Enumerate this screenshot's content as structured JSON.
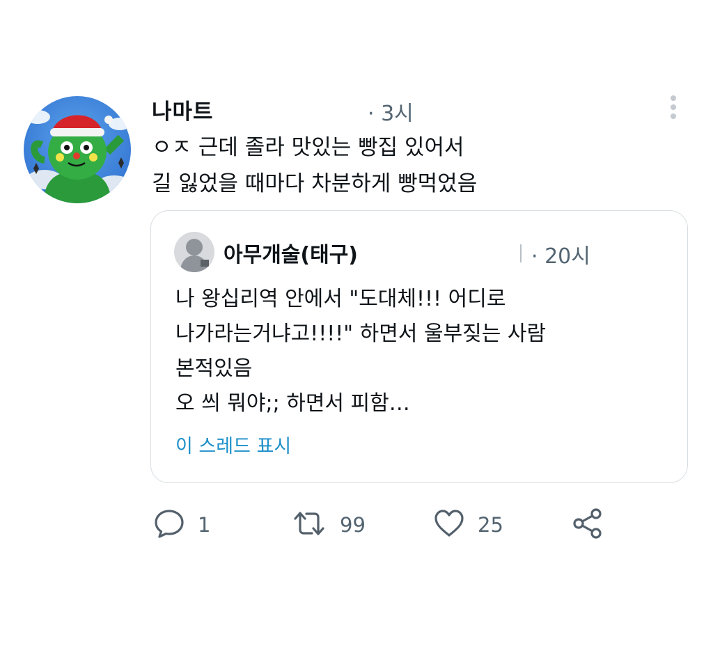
{
  "tweet": {
    "author_name": "나마트",
    "timestamp": "· 3시",
    "text_lines": [
      "ㅇㅈ 근데 졸라 맛있는 빵집 있어서",
      "길 잃었을 때마다 차분하게 빵먹었음"
    ]
  },
  "quote": {
    "author_name": "아무개술(태구)",
    "timestamp": "· 20시",
    "text_lines": [
      "나 왕십리역 안에서 \"도대체!!! 어디로",
      "나가라는거냐고!!!!\" 하면서 울부짖는 사람",
      "본적있음",
      "오 씌 뭐야;; 하면서 피함…"
    ],
    "show_thread": "이 스레드 표시"
  },
  "actions": {
    "reply_count": "1",
    "retweet_count": "99",
    "like_count": "25"
  },
  "icons": {
    "more": "more-vertical-icon",
    "reply": "reply-bubble-icon",
    "retweet": "retweet-icon",
    "like": "heart-icon",
    "share": "share-icon"
  },
  "colors": {
    "text": "#0f1419",
    "secondary_text": "#536471",
    "link": "#1d8fc9",
    "border": "#d9dee2"
  }
}
